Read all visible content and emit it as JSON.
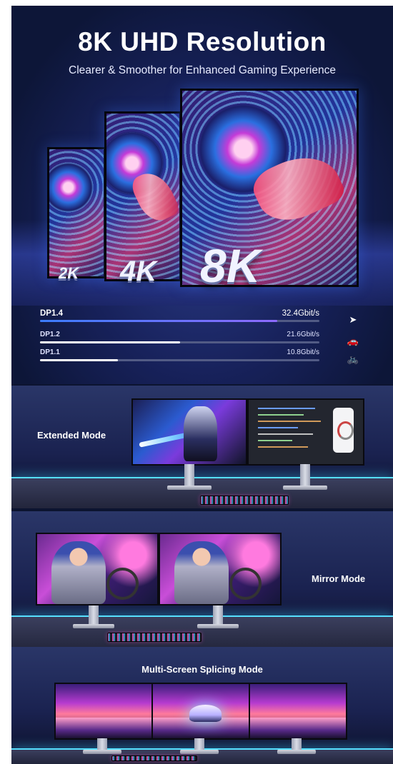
{
  "hero": {
    "title": "8K UHD Resolution",
    "subtitle": "Clearer & Smoother for Enhanced Gaming Experience",
    "resolutions": [
      "2K",
      "4K",
      "8K"
    ]
  },
  "bandwidth": [
    {
      "label": "DP1.4",
      "value": "32.4Gbit/s",
      "fraction": 0.85,
      "icon": "rocket-icon",
      "glyph": "➤"
    },
    {
      "label": "DP1.2",
      "value": "21.6Gbit/s",
      "fraction": 0.5,
      "icon": "car-icon",
      "glyph": "🚗"
    },
    {
      "label": "DP1.1",
      "value": "10.8Gbit/s",
      "fraction": 0.28,
      "icon": "bicycle-icon",
      "glyph": "🚲"
    }
  ],
  "modes": {
    "extended": "Extended Mode",
    "mirror": "Mirror Mode",
    "splicing": "Multi-Screen Splicing Mode"
  },
  "colors": {
    "background": "#0c1430",
    "accent_bar": "#3b7dff",
    "desk_glow": "#56e0ff"
  }
}
